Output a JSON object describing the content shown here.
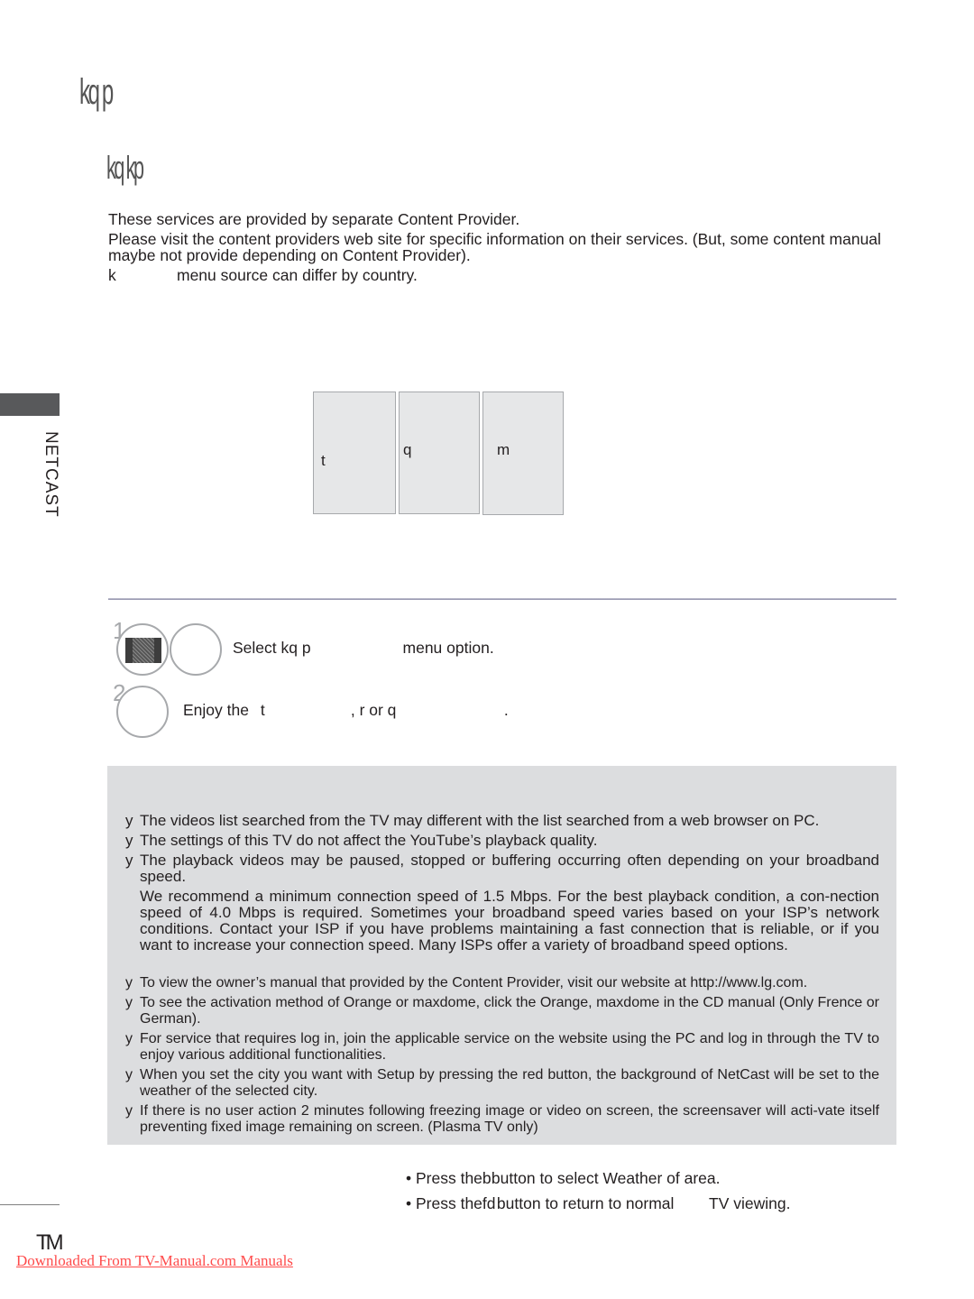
{
  "header": {
    "title": "kq p",
    "subtitle": "kq kp"
  },
  "intro": {
    "lines": [
      "These services are provided by separate Content Provider.",
      "Please visit the content providers web site for specific information on their services. (But, some content manual maybe not provide depending on Content Provider).",
      "menu source can differ by country."
    ],
    "lead_glyph": "k"
  },
  "side_tab": {
    "label": "NETCAST"
  },
  "tiles": [
    {
      "label": "t"
    },
    {
      "label": "q"
    },
    {
      "label": "m"
    }
  ],
  "steps": [
    {
      "number": "1",
      "prefix": "Select",
      "glyph": "kq p",
      "suffix": "menu option."
    },
    {
      "number": "2",
      "prefix": "Enjoy the",
      "glyph": "t",
      "middle": ", r or q",
      "suffix": "."
    }
  ],
  "notes": [
    {
      "bullet": "y",
      "text": "The videos list searched from the TV may different with the list searched from a web browser on PC."
    },
    {
      "bullet": "y",
      "text": "The settings of this TV do not affect the YouTube’s playback quality."
    },
    {
      "bullet": "y",
      "text": "The playback videos may be paused, stopped or buffering occurring often depending on your broadband speed."
    },
    {
      "bullet": "",
      "text": "We recommend a minimum connection speed of 1.5 Mbps. For the best playback condition, a con-nection speed of 4.0 Mbps is required. Sometimes your broadband speed varies based on your ISP’s network conditions. Contact your ISP if you have problems maintaining a fast connection that is reliable, or if you want to increase your connection speed. Many ISPs offer a variety of broadband speed options."
    },
    {
      "bullet": "y",
      "text": "To view the owner’s manual that provided by the Content Provider, visit our website at http://www.lg.com."
    },
    {
      "bullet": "y",
      "text": "To see the activation method of Orange or maxdome, click the Orange, maxdome in the CD manual (Only Frence or German)."
    },
    {
      "bullet": "y",
      "text": "For service that requires log in, join the applicable service on the website using the PC and log in through the TV to enjoy various additional functionalities."
    },
    {
      "bullet": "y",
      "text": "When you set the city you want with Setup by pressing the red button, the background of NetCast will be set to the weather of the selected city."
    },
    {
      "bullet": "y",
      "text": "If there is no user action 2 minutes following freezing image or video on screen, the screensaver will acti-vate itself preventing fixed image remaining on screen. (Plasma TV only)"
    }
  ],
  "bullets": [
    {
      "prefix": "• Press the",
      "glyph": "b",
      "suffix": "button to select Weather of area."
    },
    {
      "prefix": "• Press the",
      "glyph": "fd",
      "suffix": "button to return to normal        TV viewing."
    }
  ],
  "footer": {
    "page_number": "TM",
    "download_link": "Downloaded From TV-Manual.com Manuals"
  }
}
